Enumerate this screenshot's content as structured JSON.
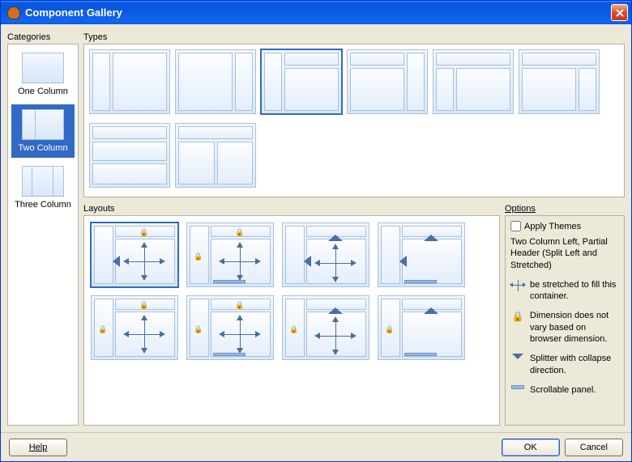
{
  "window": {
    "title": "Component Gallery"
  },
  "categories": {
    "label": "Categories",
    "items": [
      {
        "label": "One Column",
        "cols": 1
      },
      {
        "label": "Two Column",
        "cols": 2
      },
      {
        "label": "Three Column",
        "cols": 3
      }
    ],
    "selected": 1
  },
  "types": {
    "label": "Types",
    "selected": 2
  },
  "layouts": {
    "label": "Layouts",
    "selected": 0
  },
  "options": {
    "label": "Options",
    "apply_themes": "Apply Themes",
    "description": "Two Column Left, Partial Header (Split Left and Stretched)",
    "legend": {
      "stretch": "be stretched to fill this container.",
      "lock": "Dimension does not vary based on browser dimension.",
      "splitter": "Splitter with collapse direction.",
      "scroll": "Scrollable panel."
    }
  },
  "footer": {
    "help": "Help",
    "ok": "OK",
    "cancel": "Cancel"
  }
}
